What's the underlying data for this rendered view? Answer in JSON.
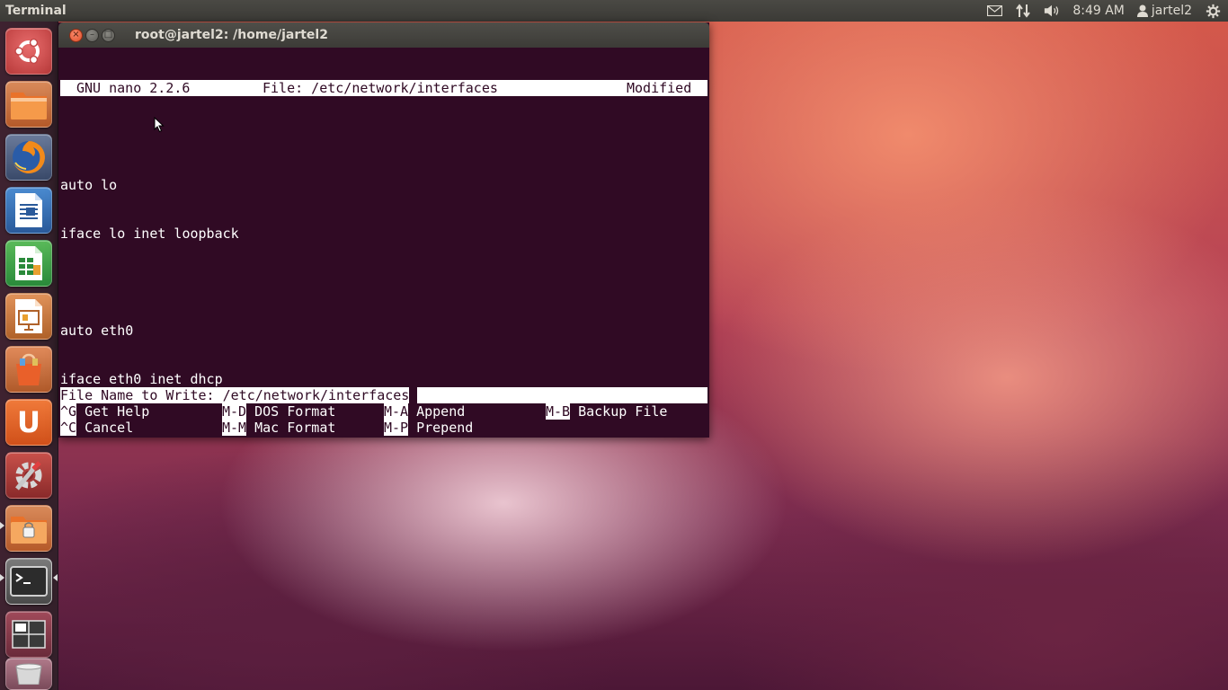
{
  "panel": {
    "app_title": "Terminal",
    "time": "8:49 AM",
    "user": "jartel2",
    "icons": [
      "mail-icon",
      "network-updown-icon",
      "volume-icon",
      "user-icon",
      "gear-icon"
    ]
  },
  "launcher": {
    "items": [
      {
        "name": "ubuntu-dash-icon"
      },
      {
        "name": "home-folder-icon"
      },
      {
        "name": "firefox-icon"
      },
      {
        "name": "libreoffice-writer-icon"
      },
      {
        "name": "libreoffice-calc-icon"
      },
      {
        "name": "libreoffice-impress-icon"
      },
      {
        "name": "software-center-icon"
      },
      {
        "name": "ubuntu-one-icon"
      },
      {
        "name": "system-settings-icon"
      },
      {
        "name": "encrypted-folder-icon"
      },
      {
        "name": "terminal-icon"
      },
      {
        "name": "workspace-switcher-icon"
      },
      {
        "name": "trash-icon"
      }
    ],
    "ubuntu_one_letter": "U"
  },
  "window": {
    "title": "root@jartel2: /home/jartel2",
    "buttons": {
      "close": "×",
      "minimize": "–",
      "maximize": "□"
    }
  },
  "nano": {
    "version": "GNU nano 2.2.6",
    "file_label": "File: /etc/network/interfaces",
    "status": "Modified",
    "lines": [
      "auto lo",
      "iface lo inet loopback",
      "",
      "auto eth0",
      "iface eth0 inet dhcp"
    ],
    "prompt": "File Name to Write: /etc/network/interfaces",
    "shortcuts_row1": [
      {
        "key": "^G",
        "label": "Get Help"
      },
      {
        "key": "M-D",
        "label": "DOS Format"
      },
      {
        "key": "M-A",
        "label": "Append"
      },
      {
        "key": "M-B",
        "label": "Backup File"
      }
    ],
    "shortcuts_row2": [
      {
        "key": "^C",
        "label": "Cancel"
      },
      {
        "key": "M-M",
        "label": "Mac Format"
      },
      {
        "key": "M-P",
        "label": "Prepend"
      }
    ]
  },
  "colors": {
    "terminal_bg": "#300a24",
    "terminal_fg": "#ffffff",
    "panel_bg": "#3c3b37"
  }
}
